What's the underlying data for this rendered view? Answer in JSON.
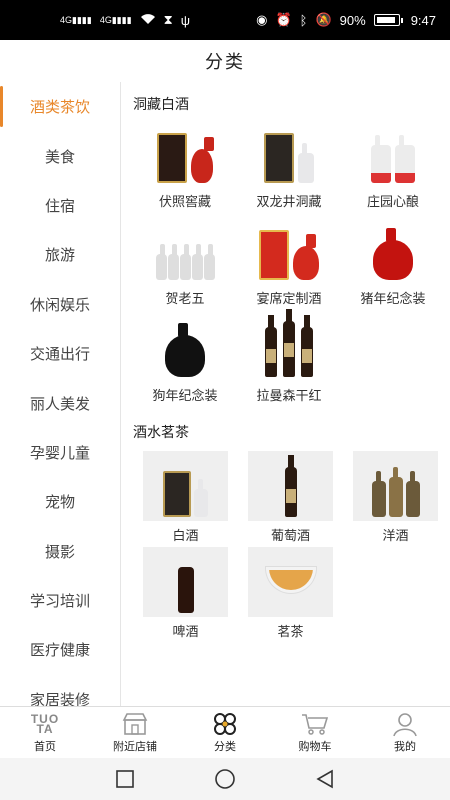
{
  "status_bar": {
    "left_icons": [
      "signal-4g-icon",
      "signal-4g-icon",
      "wifi-icon",
      "hourglass-icon",
      "usb-icon"
    ],
    "sig1": "4G",
    "sig2": "4G",
    "battery_text": "90%",
    "battery_level": 0.9,
    "time": "9:47"
  },
  "header": {
    "title": "分类"
  },
  "sidebar": {
    "active_index": 0,
    "items": [
      {
        "label": "酒类茶饮"
      },
      {
        "label": "美食"
      },
      {
        "label": "住宿"
      },
      {
        "label": "旅游"
      },
      {
        "label": "休闲娱乐"
      },
      {
        "label": "交通出行"
      },
      {
        "label": "丽人美发"
      },
      {
        "label": "孕婴儿童"
      },
      {
        "label": "宠物"
      },
      {
        "label": "摄影"
      },
      {
        "label": "学习培训"
      },
      {
        "label": "医疗健康"
      },
      {
        "label": "家居装修"
      }
    ]
  },
  "main": {
    "section1": {
      "title": "洞藏白酒",
      "items": [
        {
          "label": "伏照窖藏"
        },
        {
          "label": "双龙井洞藏"
        },
        {
          "label": "庄园心酿"
        },
        {
          "label": "贺老五"
        },
        {
          "label": "宴席定制酒"
        },
        {
          "label": "猪年纪念装"
        },
        {
          "label": "狗年纪念装"
        },
        {
          "label": "拉曼森干红"
        }
      ]
    },
    "section2": {
      "title": "酒水茗茶",
      "items": [
        {
          "label": "白酒"
        },
        {
          "label": "葡萄酒"
        },
        {
          "label": "洋酒"
        },
        {
          "label": "啤酒"
        },
        {
          "label": "茗茶"
        }
      ]
    }
  },
  "tabbar": {
    "items": [
      {
        "label": "首页",
        "logo_line1": "TUO",
        "logo_line2": "TA",
        "icon": "home-logo-icon"
      },
      {
        "label": "附近店铺",
        "icon": "store-icon"
      },
      {
        "label": "分类",
        "icon": "category-icon",
        "active": true
      },
      {
        "label": "购物车",
        "icon": "cart-icon"
      },
      {
        "label": "我的",
        "icon": "user-icon"
      }
    ]
  },
  "system_nav": {
    "buttons": [
      "recents-button",
      "home-button",
      "back-button"
    ]
  }
}
